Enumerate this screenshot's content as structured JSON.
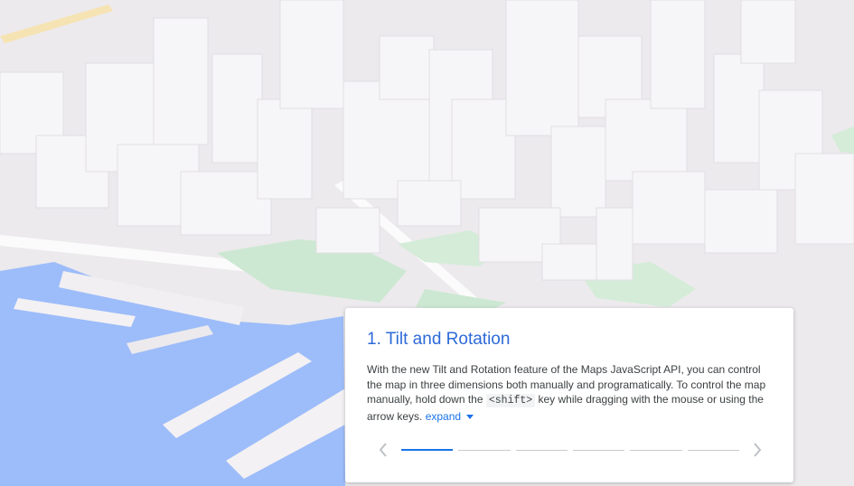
{
  "card": {
    "title": "1. Tilt and Rotation",
    "body_part1": "With the new Tilt and Rotation feature of the Maps JavaScript API, you can control the map in three dimensions both manually and programatically. To control the map manually, hold down the ",
    "key_code": "<shift>",
    "body_part2": " key while dragging with the mouse or using the arrow keys. ",
    "expand_label": "expand",
    "prev_icon": "chevron-left-icon",
    "next_icon": "chevron-right-icon",
    "steps": [
      {
        "active": true
      },
      {
        "active": false
      },
      {
        "active": false
      },
      {
        "active": false
      },
      {
        "active": false
      },
      {
        "active": false
      }
    ]
  },
  "map": {
    "water_color": "#9dbcfa",
    "park_color": "#cde8d2",
    "building_color": "#f6f4f6",
    "road_color": "#f4d99a"
  }
}
